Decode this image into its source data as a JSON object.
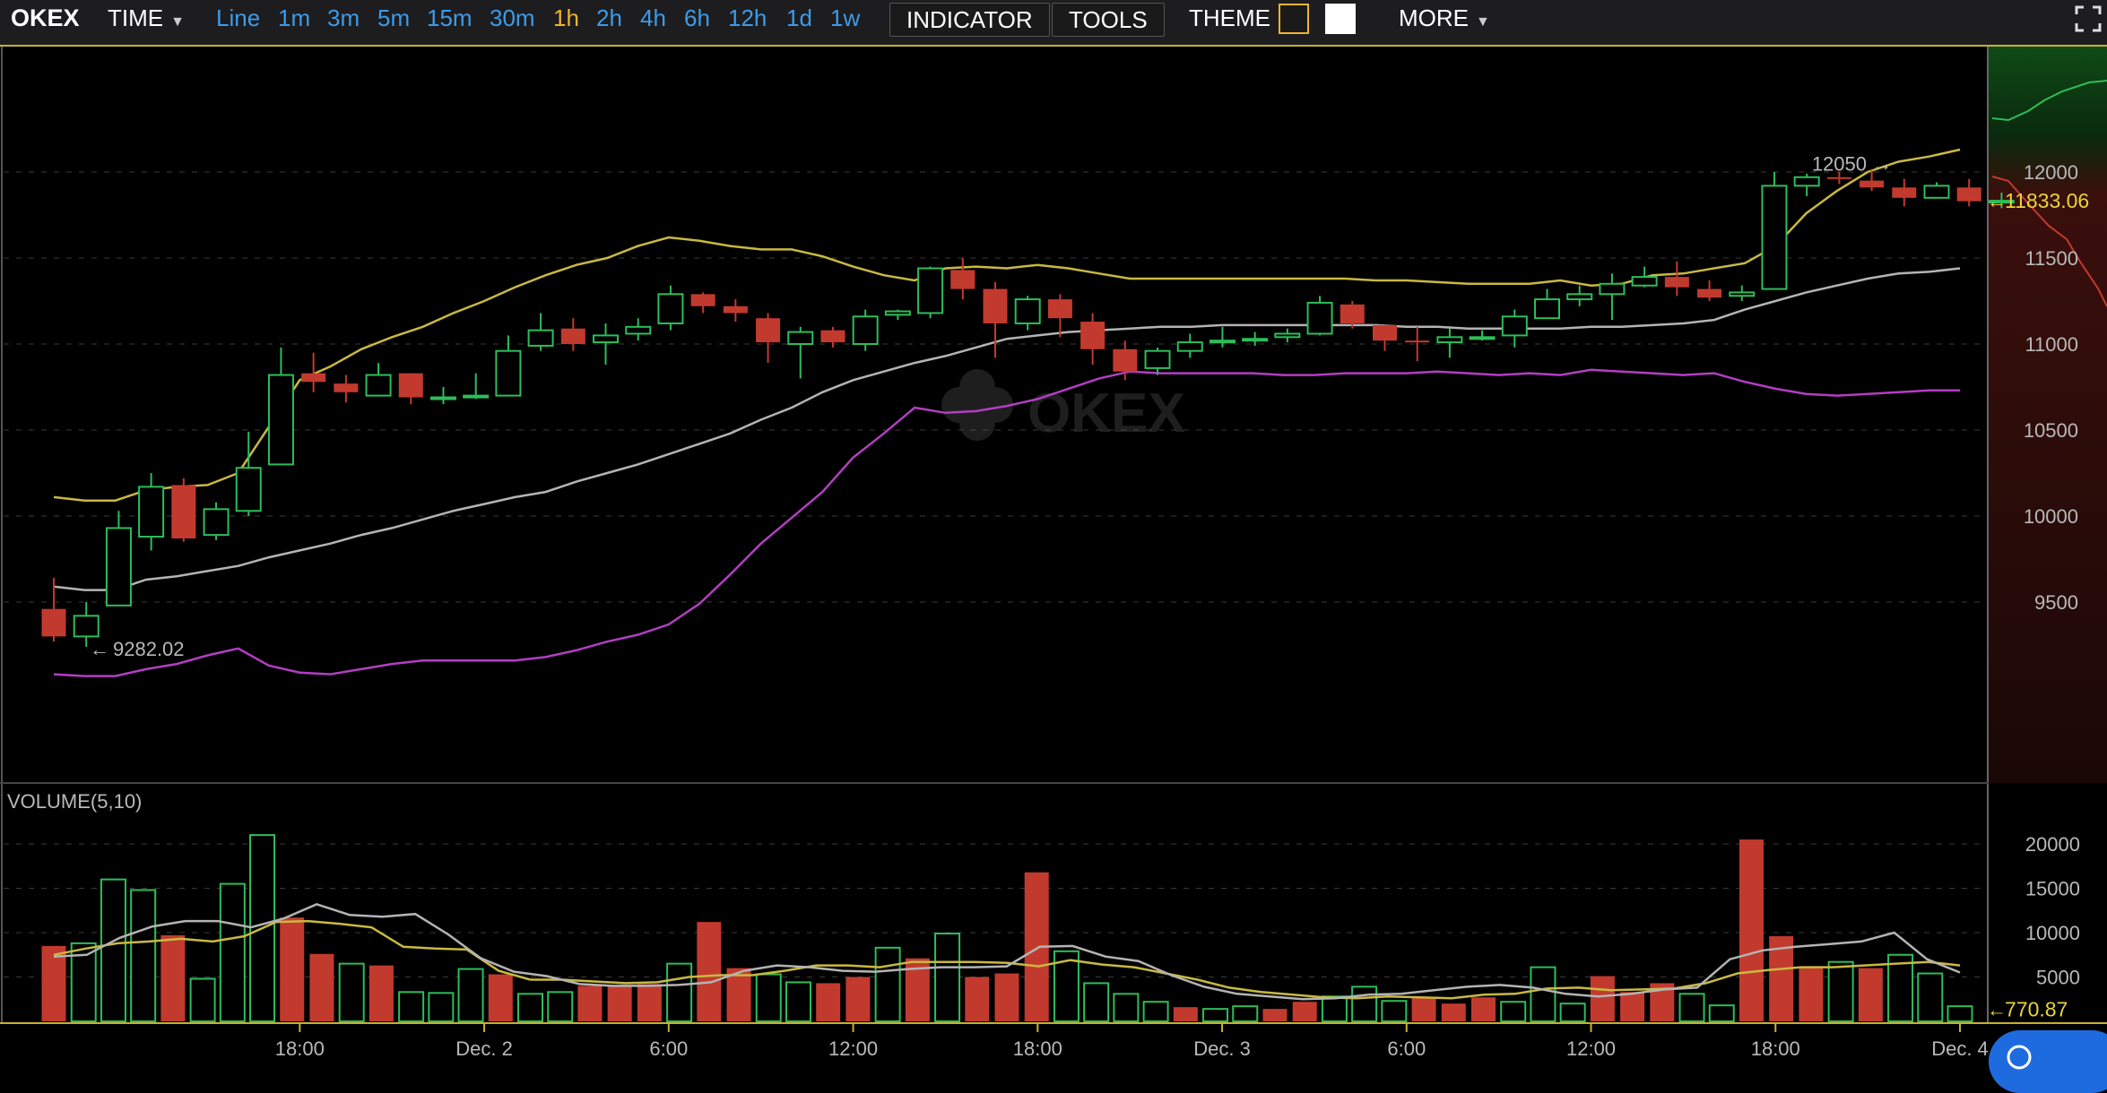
{
  "toolbar": {
    "logo": "OKEX",
    "time_label": "TIME",
    "intervals": [
      "Line",
      "1m",
      "3m",
      "5m",
      "15m",
      "30m",
      "1h",
      "2h",
      "4h",
      "6h",
      "12h",
      "1d",
      "1w"
    ],
    "active_interval": "1h",
    "indicator_label": "INDICATOR",
    "tools_label": "TOOLS",
    "theme_label": "THEME",
    "more_label": "MORE",
    "theme_dark_color": "#f0b330",
    "theme_light_color": "#ffffff"
  },
  "watermark": "OKEX",
  "colors": {
    "up": "#2dbd5a",
    "down": "#c23a2e",
    "ma_upper": "#c9b940",
    "ma_mid": "#b4b4b4",
    "ma_lower": "#b23ec2",
    "accent": "#e8d53a"
  },
  "chart_data": [
    {
      "type": "candlestick",
      "name": "price",
      "x_ticks": [
        "18:00",
        "Dec. 2",
        "6:00",
        "12:00",
        "18:00",
        "Dec. 3",
        "6:00",
        "12:00",
        "18:00",
        "Dec. 4"
      ],
      "ylim": [
        9000,
        12250
      ],
      "y_ticks": [
        9500,
        10000,
        10500,
        11000,
        11500,
        12000
      ],
      "candles": [
        [
          9460,
          9300,
          9640,
          9270
        ],
        [
          9300,
          9420,
          9500,
          9240
        ],
        [
          9480,
          9930,
          10030,
          9480
        ],
        [
          9880,
          10170,
          10250,
          9800
        ],
        [
          10180,
          9870,
          10220,
          9850
        ],
        [
          9890,
          10040,
          10080,
          9860
        ],
        [
          10030,
          10280,
          10490,
          10000
        ],
        [
          10300,
          10820,
          10980,
          10300
        ],
        [
          10830,
          10780,
          10950,
          10720
        ],
        [
          10770,
          10720,
          10820,
          10660
        ],
        [
          10700,
          10820,
          10890,
          10700
        ],
        [
          10830,
          10690,
          10830,
          10650
        ],
        [
          10680,
          10690,
          10750,
          10650
        ],
        [
          10690,
          10700,
          10830,
          10680
        ],
        [
          10700,
          10960,
          11050,
          10700
        ],
        [
          10990,
          11080,
          11180,
          10960
        ],
        [
          11090,
          11000,
          11150,
          10960
        ],
        [
          11010,
          11050,
          11120,
          10880
        ],
        [
          11060,
          11100,
          11150,
          11020
        ],
        [
          11120,
          11290,
          11340,
          11080
        ],
        [
          11290,
          11220,
          11300,
          11180
        ],
        [
          11220,
          11180,
          11260,
          11130
        ],
        [
          11150,
          11010,
          11180,
          10890
        ],
        [
          11000,
          11070,
          11100,
          10800
        ],
        [
          11080,
          11010,
          11100,
          10980
        ],
        [
          11000,
          11160,
          11200,
          10960
        ],
        [
          11170,
          11190,
          11200,
          11140
        ],
        [
          11180,
          11440,
          11450,
          11150
        ],
        [
          11430,
          11320,
          11500,
          11260
        ],
        [
          11320,
          11120,
          11360,
          10920
        ],
        [
          11120,
          11260,
          11280,
          11080
        ],
        [
          11260,
          11150,
          11290,
          11040
        ],
        [
          11130,
          10970,
          11180,
          10880
        ],
        [
          10970,
          10840,
          11020,
          10790
        ],
        [
          10860,
          10960,
          10980,
          10820
        ],
        [
          10960,
          11010,
          11060,
          10920
        ],
        [
          11010,
          11020,
          11100,
          10980
        ],
        [
          11020,
          11030,
          11070,
          10990
        ],
        [
          11040,
          11060,
          11090,
          11010
        ],
        [
          11060,
          11240,
          11280,
          11050
        ],
        [
          11230,
          11120,
          11250,
          11090
        ],
        [
          11110,
          11020,
          11110,
          10960
        ],
        [
          11020,
          11010,
          11100,
          10900
        ],
        [
          11010,
          11040,
          11090,
          10920
        ],
        [
          11040,
          11040,
          11080,
          11020
        ],
        [
          11050,
          11160,
          11200,
          10980
        ],
        [
          11150,
          11260,
          11320,
          11150
        ],
        [
          11260,
          11290,
          11340,
          11220
        ],
        [
          11290,
          11350,
          11410,
          11140
        ],
        [
          11340,
          11390,
          11450,
          11330
        ],
        [
          11390,
          11330,
          11480,
          11280
        ],
        [
          11320,
          11270,
          11370,
          11250
        ],
        [
          11280,
          11300,
          11340,
          11250
        ],
        [
          11320,
          11920,
          12000,
          11320
        ],
        [
          11920,
          11970,
          11990,
          11860
        ],
        [
          11970,
          11960,
          12000,
          11930
        ],
        [
          11950,
          11910,
          12010,
          11890
        ],
        [
          11910,
          11850,
          11960,
          11800
        ],
        [
          11850,
          11920,
          11940,
          11860
        ],
        [
          11910,
          11830,
          11960,
          11800
        ],
        [
          11833,
          11833,
          11880,
          11790
        ]
      ],
      "series": [
        {
          "name": "BOLL-UP",
          "color": "#c9b940",
          "values": [
            10110,
            10090,
            10090,
            10150,
            10170,
            10180,
            10250,
            10520,
            10790,
            10870,
            10970,
            11040,
            11100,
            11180,
            11250,
            11330,
            11400,
            11460,
            11500,
            11570,
            11620,
            11600,
            11570,
            11550,
            11550,
            11510,
            11450,
            11400,
            11370,
            11440,
            11450,
            11440,
            11460,
            11440,
            11410,
            11380,
            11380,
            11380,
            11380,
            11380,
            11380,
            11380,
            11380,
            11370,
            11370,
            11360,
            11350,
            11350,
            11350,
            11370,
            11340,
            11350,
            11400,
            11410,
            11440,
            11470,
            11570,
            11760,
            11890,
            12000,
            12060,
            12090,
            12130
          ]
        },
        {
          "name": "BOLL-MB",
          "color": "#b4b4b4",
          "values": [
            9590,
            9570,
            9570,
            9630,
            9650,
            9680,
            9710,
            9760,
            9800,
            9840,
            9890,
            9930,
            9980,
            10030,
            10070,
            10110,
            10140,
            10200,
            10250,
            10300,
            10360,
            10420,
            10480,
            10560,
            10630,
            10720,
            10790,
            10840,
            10890,
            10930,
            10980,
            11030,
            11050,
            11070,
            11080,
            11090,
            11100,
            11100,
            11110,
            11110,
            11110,
            11110,
            11110,
            11110,
            11100,
            11100,
            11090,
            11090,
            11090,
            11090,
            11100,
            11100,
            11110,
            11120,
            11140,
            11200,
            11250,
            11300,
            11340,
            11380,
            11410,
            11420,
            11440
          ]
        },
        {
          "name": "BOLL-DN",
          "color": "#b23ec2",
          "values": [
            9080,
            9070,
            9070,
            9110,
            9140,
            9190,
            9230,
            9130,
            9090,
            9080,
            9110,
            9140,
            9160,
            9160,
            9160,
            9160,
            9180,
            9220,
            9270,
            9310,
            9370,
            9490,
            9660,
            9840,
            9990,
            10140,
            10340,
            10480,
            10630,
            10600,
            10610,
            10640,
            10680,
            10740,
            10800,
            10840,
            10830,
            10830,
            10830,
            10830,
            10820,
            10820,
            10830,
            10830,
            10830,
            10840,
            10830,
            10820,
            10830,
            10820,
            10850,
            10840,
            10830,
            10820,
            10830,
            10780,
            10740,
            10710,
            10700,
            10710,
            10720,
            10730,
            10730
          ]
        }
      ],
      "annotations": [
        {
          "label": "12050",
          "value": 12050
        },
        {
          "label": "9282.02",
          "value": 9282.02
        },
        {
          "label": "11833.06",
          "value": 11833.06
        }
      ]
    },
    {
      "type": "bar",
      "name": "volume",
      "title": "VOLUME(5,10)",
      "ylim": [
        0,
        22000
      ],
      "y_ticks": [
        5000,
        10000,
        15000,
        20000
      ],
      "directions": [
        "d",
        "u",
        "u",
        "u",
        "d",
        "u",
        "u",
        "u",
        "d",
        "d",
        "u",
        "d",
        "u",
        "u",
        "u",
        "d",
        "u",
        "u",
        "d",
        "d",
        "d",
        "u",
        "d",
        "d",
        "u",
        "u",
        "d",
        "d",
        "u",
        "d",
        "u",
        "d",
        "d",
        "d",
        "u",
        "u",
        "u",
        "u",
        "d",
        "u",
        "u",
        "d",
        "d",
        "u",
        "u",
        "u",
        "d",
        "d",
        "d",
        "u",
        "u",
        "u",
        "d",
        "d",
        "d",
        "u",
        "u",
        "d",
        "d",
        "d",
        "u",
        "d",
        "u"
      ],
      "values": [
        8500,
        8800,
        16000,
        14800,
        9700,
        4800,
        15500,
        21000,
        11700,
        7600,
        6500,
        6300,
        3300,
        3200,
        5900,
        5300,
        3100,
        3300,
        4000,
        4000,
        4200,
        6500,
        11200,
        6000,
        5300,
        4400,
        4300,
        5000,
        8300,
        7100,
        9900,
        5000,
        5400,
        16800,
        7900,
        4300,
        3100,
        2200,
        1600,
        1400,
        1700,
        1400,
        2200,
        2800,
        3900,
        2300,
        2700,
        2000,
        2700,
        2200,
        6100,
        2000,
        5100,
        3300,
        4300,
        3100,
        1800,
        20500,
        9600,
        6200,
        6700,
        6000,
        7500,
        5400,
        1700
      ],
      "series": [
        {
          "name": "MA5",
          "color": "#c9b940",
          "values": [
            7500,
            8200,
            8800,
            9000,
            9300,
            9000,
            9600,
            11200,
            11300,
            11000,
            10600,
            8400,
            8200,
            8100,
            5700,
            4700,
            4700,
            4500,
            4300,
            4400,
            5000,
            5200,
            5200,
            5700,
            6300,
            6300,
            6100,
            6700,
            6700,
            6700,
            6600,
            6200,
            6900,
            6400,
            6100,
            5400,
            4700,
            3800,
            3300,
            3000,
            2700,
            2600,
            2800,
            2700,
            2600,
            3000,
            3100,
            3700,
            3800,
            3500,
            3600,
            3700,
            4300,
            5400,
            5800,
            6100,
            6100,
            6300,
            6500,
            6700,
            6300
          ]
        },
        {
          "name": "MA10",
          "color": "#b4b4b4",
          "values": [
            7300,
            7500,
            9400,
            10700,
            11300,
            11300,
            10600,
            11600,
            13200,
            12000,
            11800,
            12100,
            9800,
            7100,
            5600,
            5100,
            4200,
            4000,
            4000,
            4100,
            4400,
            5700,
            6300,
            6100,
            5700,
            5600,
            5900,
            6100,
            6100,
            6200,
            8400,
            8500,
            7300,
            6800,
            5200,
            3900,
            3100,
            2800,
            2500,
            2600,
            3000,
            3100,
            3500,
            3900,
            4100,
            3800,
            3100,
            2800,
            3100,
            3600,
            3800,
            7000,
            8000,
            8400,
            8700,
            9000,
            10000,
            7000,
            5500
          ]
        }
      ],
      "annotations": [
        {
          "label": "770.87",
          "value": 770.87
        }
      ]
    }
  ]
}
